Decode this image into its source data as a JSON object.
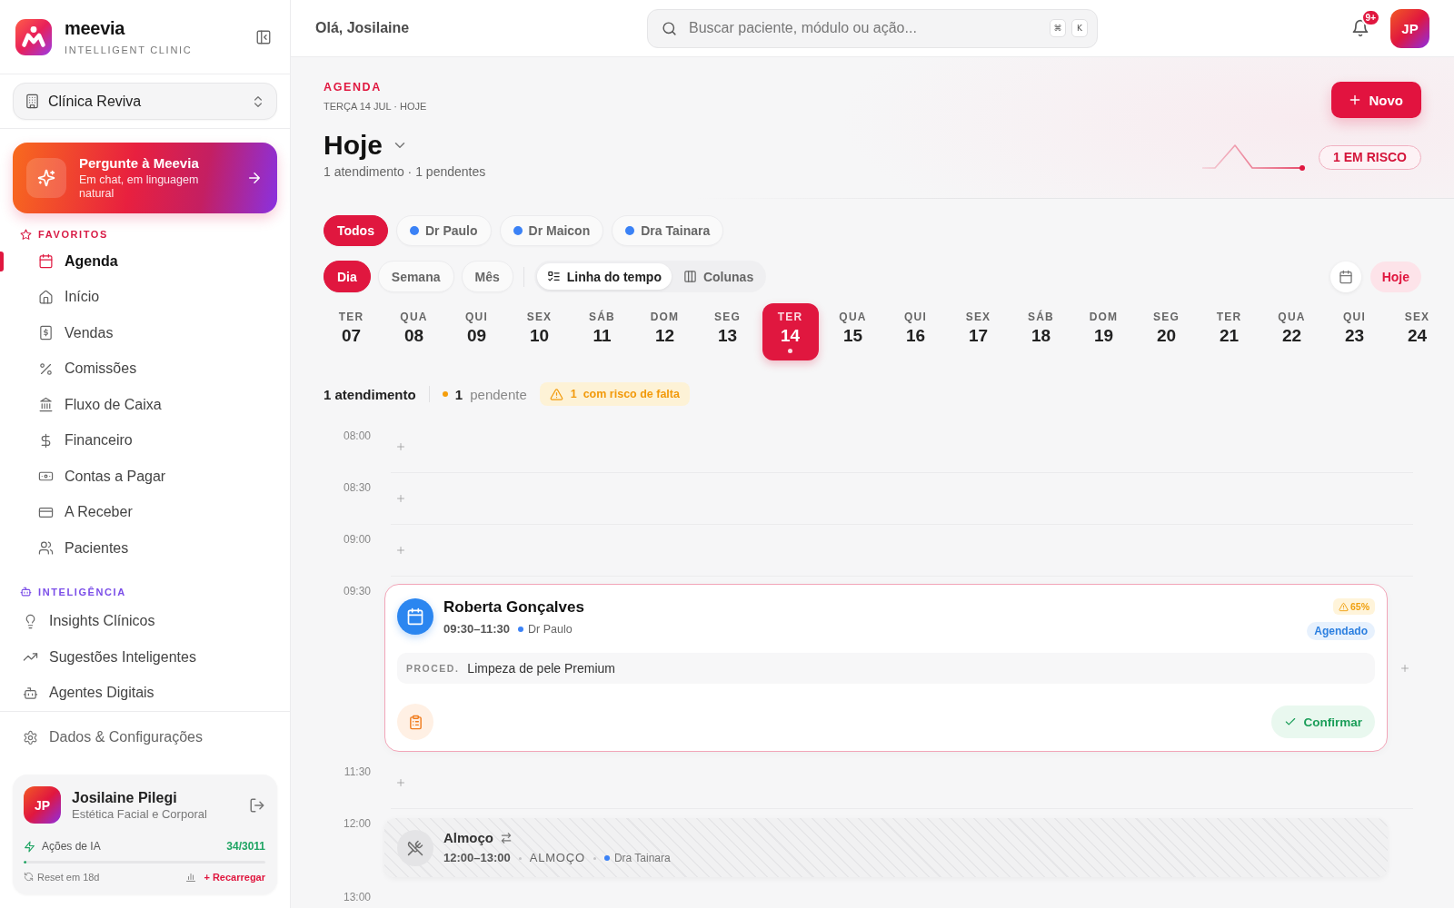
{
  "sidebar": {
    "brand": {
      "name": "meevia",
      "tagline": "INTELLIGENT CLINIC"
    },
    "clinic_selector": {
      "value": "Clínica Reviva"
    },
    "assistant": {
      "title": "Pergunte à Meevia",
      "subtitle": "Em chat, em linguagem natural"
    },
    "sections": [
      {
        "title": "FAVORITOS",
        "kind": "favorites",
        "items": [
          {
            "label": "Agenda",
            "selected": true
          },
          {
            "label": "Início",
            "selected": false
          },
          {
            "label": "Vendas",
            "selected": false
          },
          {
            "label": "Comissões",
            "selected": false
          },
          {
            "label": "Fluxo de Caixa",
            "selected": false
          },
          {
            "label": "Financeiro",
            "selected": false
          },
          {
            "label": "Contas a Pagar",
            "selected": false
          },
          {
            "label": "A Receber",
            "selected": false
          },
          {
            "label": "Pacientes",
            "selected": false
          }
        ]
      },
      {
        "title": "INTELIGÊNCIA",
        "kind": "intelligence",
        "items": [
          {
            "label": "Insights Clínicos",
            "selected": false
          },
          {
            "label": "Sugestões Inteligentes",
            "selected": false
          },
          {
            "label": "Agentes Digitais",
            "selected": false
          }
        ]
      }
    ],
    "settings": {
      "label": "Dados & Configurações"
    },
    "user": {
      "initials": "JP",
      "name": "Josilaine Pilegi",
      "role": "Estética Facial e Corporal",
      "ai_usage": {
        "label": "Ações de IA",
        "count": "34/3011",
        "level": 0.011,
        "reset": "Reset em 18d",
        "recharge": "+ Recarregar"
      }
    }
  },
  "header": {
    "greeting": "Olá, Josilaine",
    "search": {
      "placeholder": "Buscar paciente, módulo ou ação...",
      "shortcut": [
        "⌘",
        "K"
      ]
    },
    "notifications": {
      "badge": "9+"
    },
    "avatar": {
      "initials": "JP"
    }
  },
  "page": {
    "eyebrow": "AGENDA",
    "date": "TERÇA 14 JUL · HOJE",
    "title": "Hoje",
    "summary": "1 atendimento · 1 pendentes",
    "new_button": "Novo",
    "risk_badge": "1 EM RISCO"
  },
  "professional_filters": [
    {
      "label": "Todos",
      "selected": true
    },
    {
      "label": "Dr Paulo",
      "color": "#3b82f6",
      "selected": false
    },
    {
      "label": "Dr Maicon",
      "color": "#3b82f6",
      "selected": false
    },
    {
      "label": "Dra Tainara",
      "color": "#3b82f6",
      "selected": false
    }
  ],
  "period_tabs": [
    {
      "label": "Dia",
      "selected": true
    },
    {
      "label": "Semana",
      "selected": false
    },
    {
      "label": "Mês",
      "selected": false
    }
  ],
  "view_modes": [
    {
      "label": "Linha do tempo",
      "selected": true
    },
    {
      "label": "Colunas",
      "selected": false
    }
  ],
  "today_button": "Hoje",
  "days": [
    {
      "weekday": "TER",
      "day": "07",
      "selected": false,
      "has_events": false
    },
    {
      "weekday": "QUA",
      "day": "08",
      "selected": false,
      "has_events": false
    },
    {
      "weekday": "QUI",
      "day": "09",
      "selected": false,
      "has_events": false
    },
    {
      "weekday": "SEX",
      "day": "10",
      "selected": false,
      "has_events": false
    },
    {
      "weekday": "SÁB",
      "day": "11",
      "selected": false,
      "has_events": false
    },
    {
      "weekday": "DOM",
      "day": "12",
      "selected": false,
      "has_events": false
    },
    {
      "weekday": "SEG",
      "day": "13",
      "selected": false,
      "has_events": false
    },
    {
      "weekday": "TER",
      "day": "14",
      "selected": true,
      "has_events": true
    },
    {
      "weekday": "QUA",
      "day": "15",
      "selected": false,
      "has_events": false
    },
    {
      "weekday": "QUI",
      "day": "16",
      "selected": false,
      "has_events": false
    },
    {
      "weekday": "SEX",
      "day": "17",
      "selected": false,
      "has_events": false
    },
    {
      "weekday": "SÁB",
      "day": "18",
      "selected": false,
      "has_events": false
    },
    {
      "weekday": "DOM",
      "day": "19",
      "selected": false,
      "has_events": false
    },
    {
      "weekday": "SEG",
      "day": "20",
      "selected": false,
      "has_events": false
    },
    {
      "weekday": "TER",
      "day": "21",
      "selected": false,
      "has_events": false
    },
    {
      "weekday": "QUA",
      "day": "22",
      "selected": false,
      "has_events": false
    },
    {
      "weekday": "QUI",
      "day": "23",
      "selected": false,
      "has_events": false
    },
    {
      "weekday": "SEX",
      "day": "24",
      "selected": false,
      "has_events": false
    }
  ],
  "day_summary": {
    "total": "1 atendimento",
    "pending": {
      "count": "1",
      "label": "pendente"
    },
    "risk": {
      "count": "1",
      "label": "com risco de falta"
    }
  },
  "timeline": [
    {
      "time": "08:00",
      "kind": "empty"
    },
    {
      "time": "08:30",
      "kind": "empty"
    },
    {
      "time": "09:00",
      "kind": "empty"
    },
    {
      "time": "09:30",
      "kind": "appointment",
      "patient": "Roberta Gonçalves",
      "range": "09:30–11:30",
      "professional": {
        "name": "Dr Paulo",
        "color": "#3b82f6"
      },
      "risk": "65%",
      "status": "Agendado",
      "procedure_label": "PROCED.",
      "procedure": "Limpeza de pele Premium",
      "confirm_button": "Confirmar"
    },
    {
      "time": "11:30",
      "kind": "empty"
    },
    {
      "time": "12:00",
      "kind": "block",
      "title": "Almoço",
      "recurring": true,
      "range": "12:00–13:00",
      "category": "ALMOÇO",
      "professional": {
        "name": "Dra Tainara",
        "color": "#3b82f6"
      }
    },
    {
      "time": "13:00",
      "kind": "empty"
    }
  ]
}
